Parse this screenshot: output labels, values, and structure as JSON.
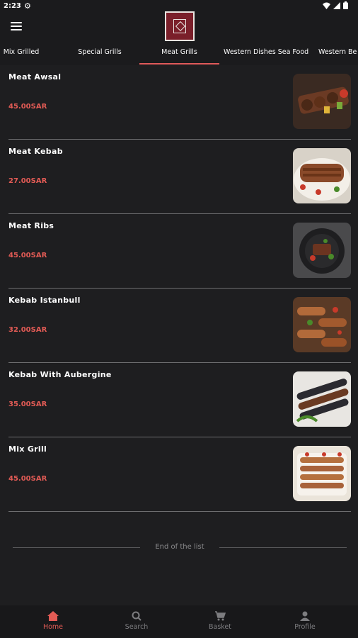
{
  "status_bar": {
    "time": "2:23"
  },
  "tabs": [
    {
      "label": "Mix Grilled",
      "active": false
    },
    {
      "label": "Special Grills",
      "active": false
    },
    {
      "label": "Meat Grills",
      "active": true
    },
    {
      "label": "Western Dishes Sea Food",
      "active": false
    },
    {
      "label": "Western Be",
      "active": false
    }
  ],
  "items": [
    {
      "name": "Meat Awsal",
      "price": "45.00SAR",
      "image_icon": "grilled-skewers-photo"
    },
    {
      "name": "Meat Kebab",
      "price": "27.00SAR",
      "image_icon": "kebab-plate-photo"
    },
    {
      "name": "Meat Ribs",
      "price": "45.00SAR",
      "image_icon": "ribs-plate-photo"
    },
    {
      "name": "Kebab Istanbull",
      "price": "32.00SAR",
      "image_icon": "kebab-istanbul-photo"
    },
    {
      "name": "Kebab With  Aubergine",
      "price": "35.00SAR",
      "image_icon": "kebab-aubergine-photo"
    },
    {
      "name": "Mix Grill",
      "price": "45.00SAR",
      "image_icon": "mix-grill-photo"
    }
  ],
  "end_of_list": "End of the list",
  "bottom_nav": [
    {
      "label": "Home",
      "icon": "home-icon",
      "active": true
    },
    {
      "label": "Search",
      "icon": "search-icon",
      "active": false
    },
    {
      "label": "Basket",
      "icon": "cart-icon",
      "active": false
    },
    {
      "label": "Profile",
      "icon": "person-icon",
      "active": false
    }
  ],
  "colors": {
    "accent": "#e25b55",
    "background": "#1e1e20",
    "logo": "#7a1f2a"
  }
}
